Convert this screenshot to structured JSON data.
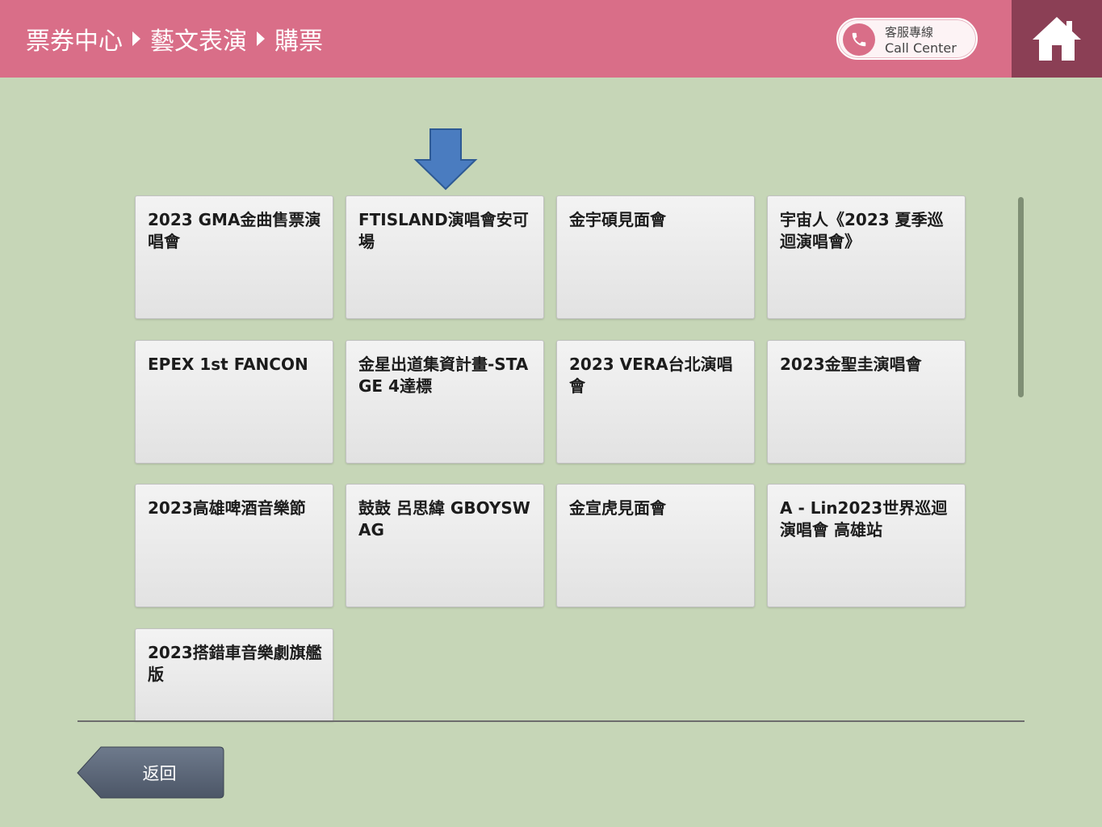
{
  "header": {
    "breadcrumb": [
      "票券中心",
      "藝文表演",
      "購票"
    ],
    "call_center": {
      "line1": "客服專線",
      "line2": "Call Center"
    },
    "home_icon": "home-icon",
    "background": "#d96e88",
    "home_background": "#8b3f55"
  },
  "main": {
    "events": [
      "2023 GMA金曲售票演唱會",
      "FTISLAND演唱會安可場",
      "金宇碩見面會",
      "宇宙人《2023 夏季巡迴演唱會》",
      "EPEX 1st FANCON",
      "金星出道集資計畫-STAGE 4達標",
      "2023 VERA台北演唱會",
      "2023金聖圭演唱會",
      "2023高雄啤酒音樂節",
      "鼓鼓 呂思緯 GBOYSWAG",
      "金宣虎見面會",
      "A - Lin2023世界巡迴演唱會 高雄站",
      "2023搭錯車音樂劇旗艦版"
    ],
    "indicator_icon": "arrow-down-icon",
    "indicator_color": "#4a7cc0"
  },
  "footer": {
    "back_label": "返回"
  }
}
